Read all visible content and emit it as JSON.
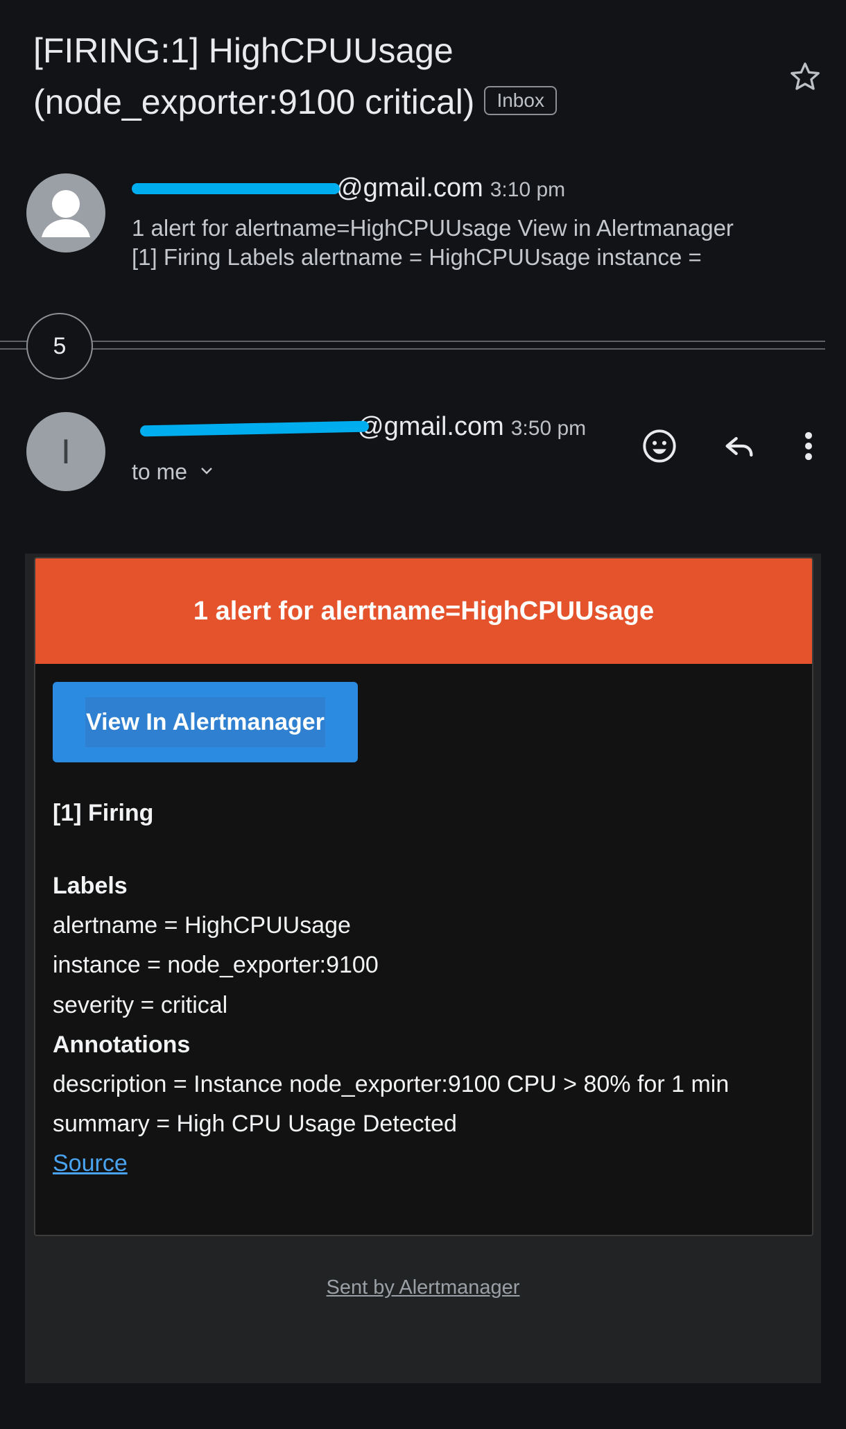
{
  "subject": {
    "line1": "[FIRING:1] HighCPUUsage",
    "line2": "(node_exporter:9100 critical)",
    "label_chip": "Inbox"
  },
  "messages": [
    {
      "sender_visible": "@gmail.com",
      "time": "3:10 pm",
      "snippet_line1": "1 alert for alertname=HighCPUUsage View in Alertmanager",
      "snippet_line2": "[1] Firing Labels alertname = HighCPUUsage instance ="
    },
    {
      "sender_visible": "@gmail.com",
      "avatar_letter": "I",
      "time": "3:50 pm",
      "recipient": "to me"
    }
  ],
  "collapsed_count": "5",
  "icons": [
    "star-icon",
    "avatar-person-icon",
    "emoji-icon",
    "reply-icon",
    "more-options-icon",
    "chevron-down-icon"
  ],
  "alert_email": {
    "header": "1 alert for alertname=HighCPUUsage",
    "button_label": "View In Alertmanager",
    "firing_title": "[1] Firing",
    "labels_title": "Labels",
    "labels": [
      "alertname = HighCPUUsage",
      "instance = node_exporter:9100",
      "severity = critical"
    ],
    "annotations_title": "Annotations",
    "annotations": [
      "description = Instance node_exporter:9100 CPU > 80% for 1 min",
      "summary = High CPU Usage Detected"
    ],
    "source_link": "Source",
    "footer": "Sent by Alertmanager"
  },
  "colors": {
    "background": "#121316",
    "header_orange": "#e5532d",
    "button_blue": "#2a8be0",
    "redaction": "#00aef0"
  }
}
